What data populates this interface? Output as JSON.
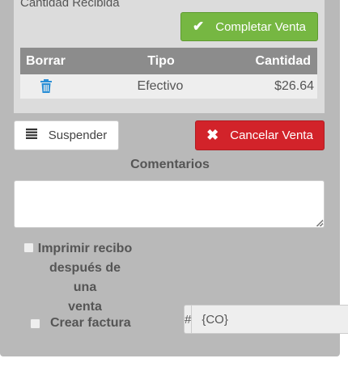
{
  "summary": {
    "received_label": "Cantidad Recibida",
    "complete_label": "Completar Venta"
  },
  "payments": {
    "headers": {
      "delete": "Borrar",
      "type": "Tipo",
      "amount": "Cantidad"
    },
    "rows": [
      {
        "type": "Efectivo",
        "amount": "$26.64"
      }
    ]
  },
  "actions": {
    "suspend_label": "Suspender",
    "cancel_label": "Cancelar Venta"
  },
  "comments": {
    "label": "Comentarios",
    "value": ""
  },
  "options": {
    "print_receipt_line1": "Imprimir recibo",
    "print_receipt_line2": "después de una",
    "print_receipt_line3": "venta",
    "print_receipt_checked": false,
    "create_invoice_label": "Crear factura",
    "create_invoice_checked": false
  },
  "invoice": {
    "prefix": "#",
    "value": "{CO}"
  },
  "colors": {
    "success": "#76b742",
    "danger": "#d2232a",
    "icon_blue": "#2a8fd6"
  }
}
